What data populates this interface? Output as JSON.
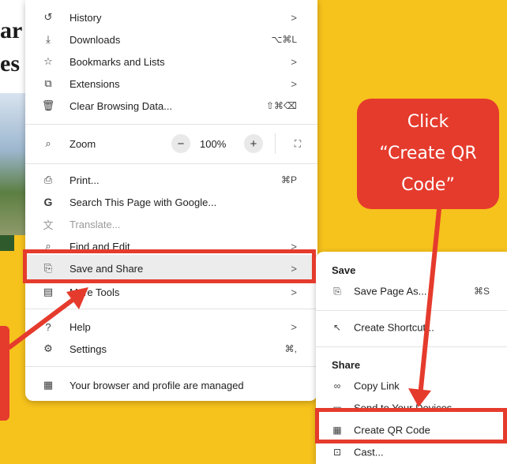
{
  "background_page": {
    "headline_fragments": [
      "ar",
      "es"
    ]
  },
  "menu": {
    "items": [
      {
        "icon": "history-icon",
        "label": "History",
        "trailing": ">"
      },
      {
        "icon": "download-icon",
        "label": "Downloads",
        "trailing": "⌥⌘L"
      },
      {
        "icon": "star-icon",
        "label": "Bookmarks and Lists",
        "trailing": ">"
      },
      {
        "icon": "puzzle-icon",
        "label": "Extensions",
        "trailing": ">"
      },
      {
        "icon": "trash-icon",
        "label": "Clear Browsing Data...",
        "trailing": "⇧⌘⌫"
      }
    ],
    "zoom": {
      "label": "Zoom",
      "minus": "−",
      "value": "100%",
      "plus": "+",
      "fullscreen": "⛶"
    },
    "items2": [
      {
        "icon": "print-icon",
        "label": "Print...",
        "trailing": "⌘P"
      },
      {
        "icon": "google-icon",
        "label": "Search This Page with Google...",
        "trailing": ""
      },
      {
        "icon": "translate-icon",
        "label": "Translate...",
        "trailing": ""
      },
      {
        "icon": "find-icon",
        "label": "Find and Edit",
        "trailing": ">"
      },
      {
        "icon": "save-share-icon",
        "label": "Save and Share",
        "trailing": ">"
      },
      {
        "icon": "more-tools-icon",
        "label": "More Tools",
        "trailing": ">"
      }
    ],
    "items3": [
      {
        "icon": "help-icon",
        "label": "Help",
        "trailing": ">"
      },
      {
        "icon": "settings-icon",
        "label": "Settings",
        "trailing": "⌘,"
      }
    ],
    "managed": {
      "icon": "managed-icon",
      "label": "Your browser and profile are managed"
    }
  },
  "submenu": {
    "save_heading": "Save",
    "save_page": {
      "label": "Save Page As...",
      "shortcut": "⌘S"
    },
    "create_shortcut": {
      "label": "Create Shortcut..."
    },
    "share_heading": "Share",
    "copy_link": {
      "label": "Copy Link"
    },
    "send_devices": {
      "label": "Send to Your Devices"
    },
    "create_qr": {
      "label": "Create QR Code"
    },
    "cast": {
      "label": "Cast..."
    }
  },
  "annotation": {
    "callout_lines": [
      "Click",
      "“Create QR",
      "Code”"
    ],
    "accent_color": "#e53b2d"
  }
}
